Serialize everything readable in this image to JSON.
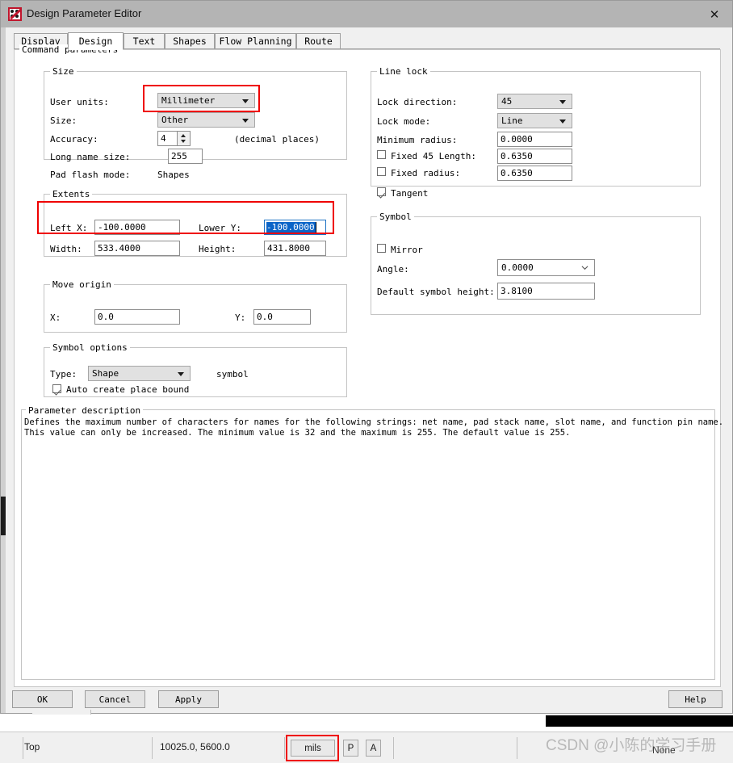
{
  "window": {
    "title": "Design Parameter Editor",
    "icon": "allegro-app-icon",
    "close_label": "✕"
  },
  "tabs": [
    {
      "label": "Display",
      "active": false
    },
    {
      "label": "Design",
      "active": true
    },
    {
      "label": "Text",
      "active": false
    },
    {
      "label": "Shapes",
      "active": false
    },
    {
      "label": "Flow Planning",
      "active": false
    },
    {
      "label": "Route",
      "active": false
    }
  ],
  "command_parameters": {
    "legend": "Command parameters"
  },
  "size_group": {
    "legend": "Size",
    "user_units_label": "User units:",
    "user_units_value": "Millimeter",
    "size_label": "Size:",
    "size_value": "Other",
    "accuracy_label": "Accuracy:",
    "accuracy_value": "4",
    "accuracy_suffix": "(decimal places)",
    "long_name_size_label": "Long name size:",
    "long_name_size_value": "255",
    "pad_flash_mode_label": "Pad flash mode:",
    "pad_flash_mode_value": "Shapes"
  },
  "extents_group": {
    "legend": "Extents",
    "left_x_label": "Left X:",
    "left_x_value": "-100.0000",
    "lower_y_label": "Lower Y:",
    "lower_y_value": "-100.0000",
    "width_label": "Width:",
    "width_value": "533.4000",
    "height_label": "Height:",
    "height_value": "431.8000"
  },
  "move_origin_group": {
    "legend": "Move origin",
    "x_label": "X:",
    "x_value": "0.0",
    "y_label": "Y:",
    "y_value": "0.0"
  },
  "symbol_options_group": {
    "legend": "Symbol options",
    "type_label": "Type:",
    "type_value": "Shape",
    "symbol_suffix": "symbol",
    "auto_create_label": "Auto create place bound",
    "auto_create_checked": true
  },
  "line_lock_group": {
    "legend": "Line lock",
    "lock_direction_label": "Lock direction:",
    "lock_direction_value": "45",
    "lock_mode_label": "Lock mode:",
    "lock_mode_value": "Line",
    "minimum_radius_label": "Minimum radius:",
    "minimum_radius_value": "0.0000",
    "fixed_45_length_label": "Fixed 45 Length:",
    "fixed_45_length_value": "0.6350",
    "fixed_45_length_checked": false,
    "fixed_radius_label": "Fixed radius:",
    "fixed_radius_value": "0.6350",
    "fixed_radius_checked": false,
    "tangent_label": "Tangent",
    "tangent_checked": true
  },
  "symbol_group": {
    "legend": "Symbol",
    "mirror_label": "Mirror",
    "mirror_checked": false,
    "angle_label": "Angle:",
    "angle_value": "0.0000",
    "default_symbol_height_label": "Default symbol height:",
    "default_symbol_height_value": "3.8100"
  },
  "parameter_description": {
    "legend": "Parameter description",
    "line1": "Defines the maximum number of characters for names for the following strings: net name, pad stack name, slot name, and function pin name.",
    "line2": "This value can only be increased. The minimum value is 32 and the maximum is 255. The default value is 255."
  },
  "buttons": {
    "ok": "OK",
    "cancel": "Cancel",
    "apply": "Apply",
    "help": "Help"
  },
  "status_bar": {
    "layer": "Top",
    "coordinates": "10025.0, 5600.0",
    "units_button": "mils",
    "p_button": "P",
    "a_button": "A",
    "none_label": "None"
  },
  "watermark": {
    "text": "CSDN @小陈的学习手册"
  },
  "colors": {
    "highlight_red": "#ef0000",
    "selection_blue": "#0a64c8",
    "focus_border": "#1f73c4",
    "titlebar": "#b4b4b4"
  }
}
